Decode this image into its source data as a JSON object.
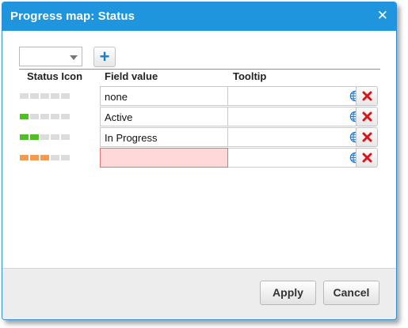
{
  "dialog": {
    "title": "Progress map: Status",
    "close_glyph": "✕"
  },
  "toolbar": {
    "select_value": "",
    "add_glyph": "+"
  },
  "columns": {
    "status_icon": "Status Icon",
    "field_value": "Field value",
    "tooltip": "Tooltip"
  },
  "colors": {
    "empty_segment": "#dcdcdc",
    "green_segment": "#4fbf26",
    "orange_segment": "#f29a52",
    "delete_red": "#d9141b",
    "globe_blue": "#2979c9"
  },
  "rows": [
    {
      "field_value": "none",
      "tooltip": "",
      "progress_filled": 0,
      "segments_total": 5,
      "fill_color": "#4fbf26",
      "invalid": false
    },
    {
      "field_value": "Active",
      "tooltip": "",
      "progress_filled": 1,
      "segments_total": 5,
      "fill_color": "#4fbf26",
      "invalid": false
    },
    {
      "field_value": "In Progress",
      "tooltip": "",
      "progress_filled": 2,
      "segments_total": 5,
      "fill_color": "#4fbf26",
      "invalid": false
    },
    {
      "field_value": "",
      "tooltip": "",
      "progress_filled": 3,
      "segments_total": 5,
      "fill_color": "#f29a52",
      "invalid": true
    }
  ],
  "footer": {
    "apply_label": "Apply",
    "cancel_label": "Cancel"
  }
}
